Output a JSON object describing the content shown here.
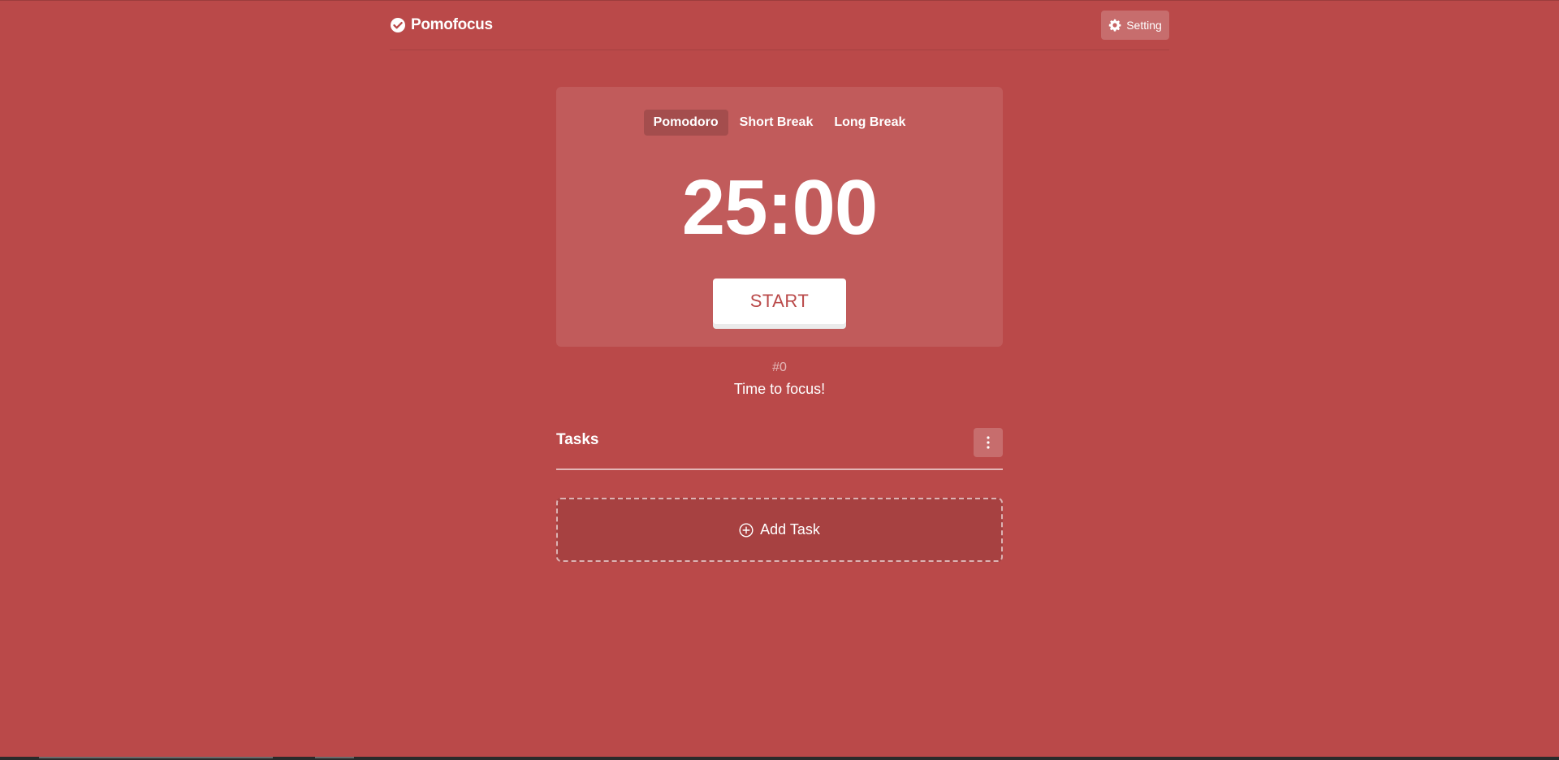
{
  "app": {
    "name": "Pomofocus",
    "accent_color": "#ba4949"
  },
  "header": {
    "logo_icon": "check-circle-icon",
    "setting_label": "Setting",
    "setting_icon": "gear-icon"
  },
  "timer": {
    "modes": [
      {
        "label": "Pomodoro",
        "active": true
      },
      {
        "label": "Short Break",
        "active": false
      },
      {
        "label": "Long Break",
        "active": false
      }
    ],
    "time": "25:00",
    "start_label": "START"
  },
  "session": {
    "count": "#0",
    "message": "Time to focus!"
  },
  "tasks": {
    "title": "Tasks",
    "menu_icon": "vertical-dots-icon",
    "add_label": "Add Task",
    "add_icon": "plus-circle-icon"
  }
}
